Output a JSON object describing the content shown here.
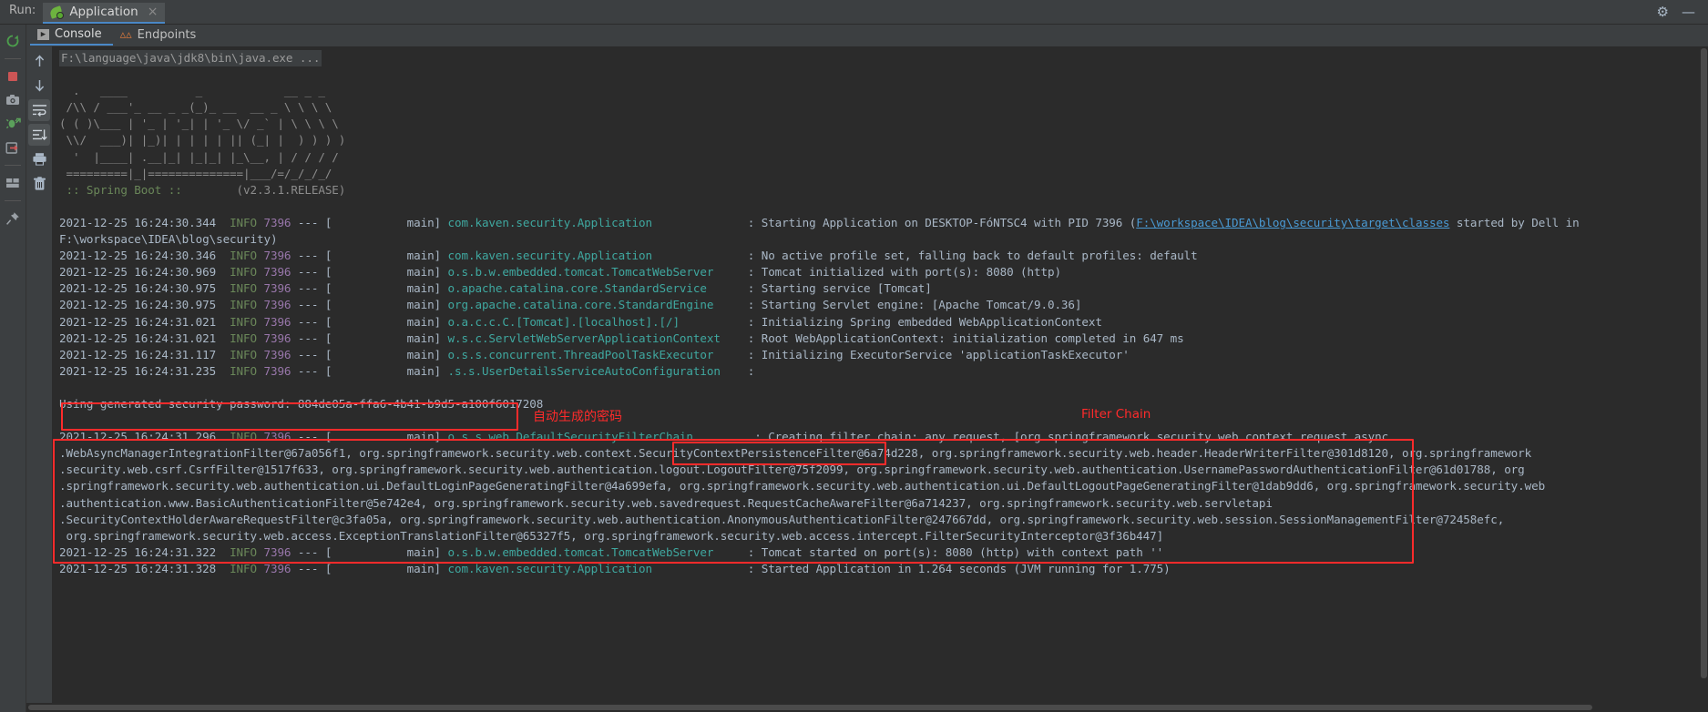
{
  "window": {
    "run_label": "Run:",
    "tab_title": "Application",
    "tab_close": "×",
    "gear_icon": "⚙",
    "minimize_icon": "—"
  },
  "toolbar_left": [
    {
      "name": "rerun-button",
      "icon": "rerun",
      "color": "#4c9f4c"
    },
    {
      "name": "stop-button",
      "icon": "stop",
      "color": "#cc5555"
    },
    {
      "name": "screenshot-button",
      "icon": "camera",
      "color": "#9aa0a6"
    },
    {
      "name": "restart-debug-button",
      "icon": "bug-restart",
      "color": "#5ba05b"
    },
    {
      "name": "exit-button",
      "icon": "exit-arrow",
      "color": "#cc5555"
    },
    {
      "name": "layout-button",
      "icon": "layout",
      "color": "#9aa0a6"
    },
    {
      "name": "pin-tab-button",
      "icon": "pin",
      "color": "#9aa0a6"
    }
  ],
  "toolbar_console": [
    {
      "name": "scroll-up-button",
      "icon": "↑"
    },
    {
      "name": "scroll-down-button",
      "icon": "↓"
    },
    {
      "name": "soft-wrap-button",
      "icon": "wrap"
    },
    {
      "name": "scroll-to-end-button",
      "icon": "scrollend"
    },
    {
      "name": "print-button",
      "icon": "printer"
    },
    {
      "name": "clear-all-button",
      "icon": "trash"
    }
  ],
  "tabs": [
    {
      "label": "Console",
      "selected": true,
      "icon": "console-icon"
    },
    {
      "label": "Endpoints",
      "selected": false,
      "icon": "endpoints-icon"
    }
  ],
  "console": {
    "command_line": "F:\\language\\java\\jdk8\\bin\\java.exe ...",
    "banner": [
      "  .   ____          _            __ _ _",
      " /\\\\ / ___'_ __ _ _(_)_ __  __ _ \\ \\ \\ \\",
      "( ( )\\___ | '_ | '_| | '_ \\/ _` | \\ \\ \\ \\",
      " \\\\/  ___)| |_)| | | | | || (_| |  ) ) ) )",
      "  '  |____| .__|_| |_|_| |_\\__, | / / / /",
      " =========|_|==============|___/=/_/_/_/"
    ],
    "banner_version_label": " :: Spring Boot :: ",
    "banner_version": "       (v2.3.1.RELEASE)",
    "lines": [
      {
        "ts": "2021-12-25 16:24:30.344",
        "level": "INFO",
        "pid": "7396",
        "dashes": "--- [",
        "thread": "           main]",
        "logger": "com.kaven.security.Application",
        "logger_pad": 42,
        "sep": "  : ",
        "msg_pre": "Starting Application on DESKTOP-FóNTSC4 with PID 7396 (",
        "link": "F:\\workspace\\IDEA\\blog\\security\\target\\classes",
        "msg_post": " started by Dell in"
      },
      {
        "continuation": "F:\\workspace\\IDEA\\blog\\security)"
      },
      {
        "ts": "2021-12-25 16:24:30.346",
        "level": "INFO",
        "pid": "7396",
        "dashes": "--- [",
        "thread": "           main]",
        "logger": "com.kaven.security.Application",
        "logger_pad": 42,
        "sep": "  : ",
        "msg": "No active profile set, falling back to default profiles: default"
      },
      {
        "ts": "2021-12-25 16:24:30.969",
        "level": "INFO",
        "pid": "7396",
        "dashes": "--- [",
        "thread": "           main]",
        "logger": "o.s.b.w.embedded.tomcat.TomcatWebServer",
        "logger_pad": 42,
        "sep": "  : ",
        "msg": "Tomcat initialized with port(s): 8080 (http)"
      },
      {
        "ts": "2021-12-25 16:24:30.975",
        "level": "INFO",
        "pid": "7396",
        "dashes": "--- [",
        "thread": "           main]",
        "logger": "o.apache.catalina.core.StandardService",
        "logger_pad": 42,
        "sep": "  : ",
        "msg": "Starting service [Tomcat]"
      },
      {
        "ts": "2021-12-25 16:24:30.975",
        "level": "INFO",
        "pid": "7396",
        "dashes": "--- [",
        "thread": "           main]",
        "logger": "org.apache.catalina.core.StandardEngine",
        "logger_pad": 42,
        "sep": "  : ",
        "msg": "Starting Servlet engine: [Apache Tomcat/9.0.36]"
      },
      {
        "ts": "2021-12-25 16:24:31.021",
        "level": "INFO",
        "pid": "7396",
        "dashes": "--- [",
        "thread": "           main]",
        "logger": "o.a.c.c.C.[Tomcat].[localhost].[/]",
        "logger_pad": 42,
        "sep": "  : ",
        "msg": "Initializing Spring embedded WebApplicationContext"
      },
      {
        "ts": "2021-12-25 16:24:31.021",
        "level": "INFO",
        "pid": "7396",
        "dashes": "--- [",
        "thread": "           main]",
        "logger": "w.s.c.ServletWebServerApplicationContext",
        "logger_pad": 42,
        "sep": "  : ",
        "msg": "Root WebApplicationContext: initialization completed in 647 ms"
      },
      {
        "ts": "2021-12-25 16:24:31.117",
        "level": "INFO",
        "pid": "7396",
        "dashes": "--- [",
        "thread": "           main]",
        "logger": "o.s.s.concurrent.ThreadPoolTaskExecutor",
        "logger_pad": 42,
        "sep": "  : ",
        "msg": "Initializing ExecutorService 'applicationTaskExecutor'"
      },
      {
        "ts": "2021-12-25 16:24:31.235",
        "level": "INFO",
        "pid": "7396",
        "dashes": "--- [",
        "thread": "           main]",
        "logger": ".s.s.UserDetailsServiceAutoConfiguration",
        "logger_pad": 42,
        "sep": "  : ",
        "msg": ""
      }
    ],
    "password_line": "Using generated security password: 884de05a-ffa6-4b41-b9d5-a100f6017208",
    "filter_chain_line": {
      "ts": "2021-12-25 16:24:31.296",
      "level": "INFO",
      "pid": "7396",
      "dashes": "--- [",
      "thread": "           main]",
      "logger": "o.s.s.web.DefaultSecurityFilterChain",
      "logger_pad": 42,
      "sep": "   : ",
      "highlight": "Creating filter chain: any request",
      "msg_post": ", [org.springframework.security.web.context.request.async"
    },
    "filter_chain_cont": [
      ".WebAsyncManagerIntegrationFilter@67a056f1, org.springframework.security.web.context.SecurityContextPersistenceFilter@6a74d228, org.springframework.security.web.header.HeaderWriterFilter@301d8120, org.springframework",
      ".security.web.csrf.CsrfFilter@1517f633, org.springframework.security.web.authentication.logout.LogoutFilter@75f2099, org.springframework.security.web.authentication.UsernamePasswordAuthenticationFilter@61d01788, org",
      ".springframework.security.web.authentication.ui.DefaultLoginPageGeneratingFilter@4a699efa, org.springframework.security.web.authentication.ui.DefaultLogoutPageGeneratingFilter@1dab9dd6, org.springframework.security.web",
      ".authentication.www.BasicAuthenticationFilter@5e742e4, org.springframework.security.web.savedrequest.RequestCacheAwareFilter@6a714237, org.springframework.security.web.servletapi",
      ".SecurityContextHolderAwareRequestFilter@c3fa05a, org.springframework.security.web.authentication.AnonymousAuthenticationFilter@247667dd, org.springframework.security.web.session.SessionManagementFilter@72458efc,",
      " org.springframework.security.web.access.ExceptionTranslationFilter@65327f5, org.springframework.security.web.access.intercept.FilterSecurityInterceptor@3f36b447]"
    ],
    "tail_lines": [
      {
        "ts": "2021-12-25 16:24:31.322",
        "level": "INFO",
        "pid": "7396",
        "dashes": "--- [",
        "thread": "           main]",
        "logger": "o.s.b.w.embedded.tomcat.TomcatWebServer",
        "logger_pad": 42,
        "sep": "  : ",
        "msg": "Tomcat started on port(s): 8080 (http) with context path ''"
      },
      {
        "ts": "2021-12-25 16:24:31.328",
        "level": "INFO",
        "pid": "7396",
        "dashes": "--- [",
        "thread": "           main]",
        "logger": "com.kaven.security.Application",
        "logger_pad": 42,
        "sep": "  : ",
        "msg": "Started Application in 1.264 seconds (JVM running for 1.775)"
      }
    ]
  },
  "annotations": {
    "password_note": "自动生成的密码",
    "filter_chain_note": "Filter Chain",
    "box_color": "#ff2b2b"
  }
}
